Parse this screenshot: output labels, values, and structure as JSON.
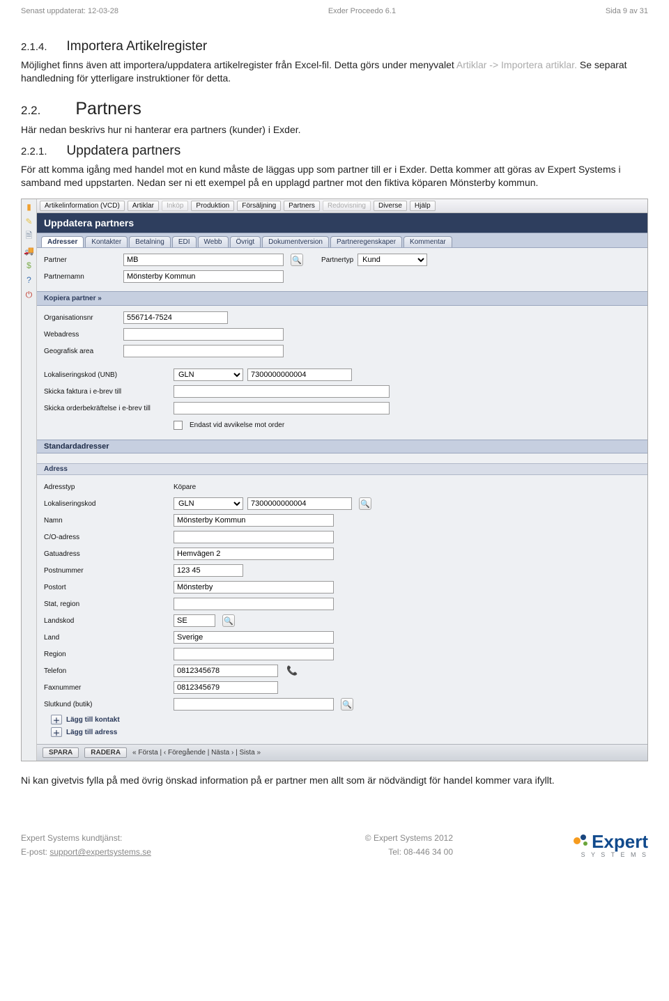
{
  "header": {
    "updated": "Senast uppdaterat: 12-03-28",
    "docname": "Exder Proceedo 6.1",
    "page": "Sida 9 av 31"
  },
  "section_214": {
    "num": "2.1.4.",
    "title": "Importera Artikelregister",
    "p1a": "Möjlighet finns även att importera/uppdatera artikelregister från Excel-fil. Detta görs under menyvalet ",
    "p1b": "Artiklar -> Importera artiklar.",
    "p1c": " Se separat handledning för ytterligare instruktioner för detta."
  },
  "section_22": {
    "num": "2.2.",
    "title": "Partners",
    "p1": "Här nedan beskrivs hur ni hanterar era partners (kunder) i Exder."
  },
  "section_221": {
    "num": "2.2.1.",
    "title": "Uppdatera partners",
    "p1": "För att komma igång med handel mot en kund måste de läggas upp som partner till er i Exder. Detta kommer att göras av Expert Systems i samband med uppstarten. Nedan ser ni ett exempel på en upplagd partner mot den fiktiva köparen Mönsterby kommun."
  },
  "shot": {
    "menubar": [
      "Artikelinformation (VCD)",
      "Artiklar",
      "Inköp",
      "Produktion",
      "Försäljning",
      "Partners",
      "Redovisning",
      "Diverse",
      "Hjälp"
    ],
    "menubar_disabled": [
      2,
      6
    ],
    "panel_title": "Uppdatera partners",
    "tabs": [
      "Adresser",
      "Kontakter",
      "Betalning",
      "EDI",
      "Webb",
      "Övrigt",
      "Dokumentversion",
      "Partneregenskaper",
      "Kommentar"
    ],
    "partner_label": "Partner",
    "partner_value": "MB",
    "partnertyp_label": "Partnertyp",
    "partnertyp_value": "Kund",
    "partnernamn_label": "Partnernamn",
    "partnernamn_value": "Mönsterby Kommun",
    "kopiera": "Kopiera partner »",
    "org_label": "Organisationsnr",
    "org_value": "556714-7524",
    "web_label": "Webadress",
    "geo_label": "Geografisk area",
    "lokkod_label": "Lokaliseringskod (UNB)",
    "lokkod_select": "GLN",
    "lokkod_value": "7300000000004",
    "faktura_label": "Skicka faktura i e-brev till",
    "orderbek_label": "Skicka orderbekräftelse i e-brev till",
    "avvik_label": "Endast vid avvikelse mot order",
    "std_title": "Standardadresser",
    "adress_sub": "Adress",
    "adresstyp_label": "Adresstyp",
    "adresstyp_value": "Köpare",
    "addr_lok_label": "Lokaliseringskod",
    "addr_lok_select": "GLN",
    "addr_lok_value": "7300000000004",
    "namn_label": "Namn",
    "namn_value": "Mönsterby Kommun",
    "co_label": "C/O-adress",
    "gatu_label": "Gatuadress",
    "gatu_value": "Hemvägen 2",
    "postnr_label": "Postnummer",
    "postnr_value": "123 45",
    "postort_label": "Postort",
    "postort_value": "Mönsterby",
    "stat_label": "Stat, region",
    "landkod_label": "Landskod",
    "landkod_value": "SE",
    "land_label": "Land",
    "land_value": "Sverige",
    "region_label": "Region",
    "telefon_label": "Telefon",
    "telefon_value": "0812345678",
    "fax_label": "Faxnummer",
    "fax_value": "0812345679",
    "slutkund_label": "Slutkund (butik)",
    "add_kontakt": "Lägg till kontakt",
    "add_adress": "Lägg till adress",
    "footer_spara": "SPARA",
    "footer_radera": "RADERA",
    "footer_nav": "«  Första  |  ‹  Föregående  |  Nästa  ›  |  Sista  »"
  },
  "after_shot": "Ni kan givetvis fylla på med övrig önskad information på er partner men allt som är nödvändigt för handel kommer vara ifyllt.",
  "footer": {
    "line1_left": "Expert Systems kundtjänst:",
    "line1_right": "© Expert Systems 2012",
    "line2_left_prefix": "E-post: ",
    "line2_left_link": "support@expertsystems.se",
    "line2_right": "Tel: 08-446 34 00",
    "logo_main": "Expert",
    "logo_sub": "S  Y  S  T  E  M  S"
  }
}
